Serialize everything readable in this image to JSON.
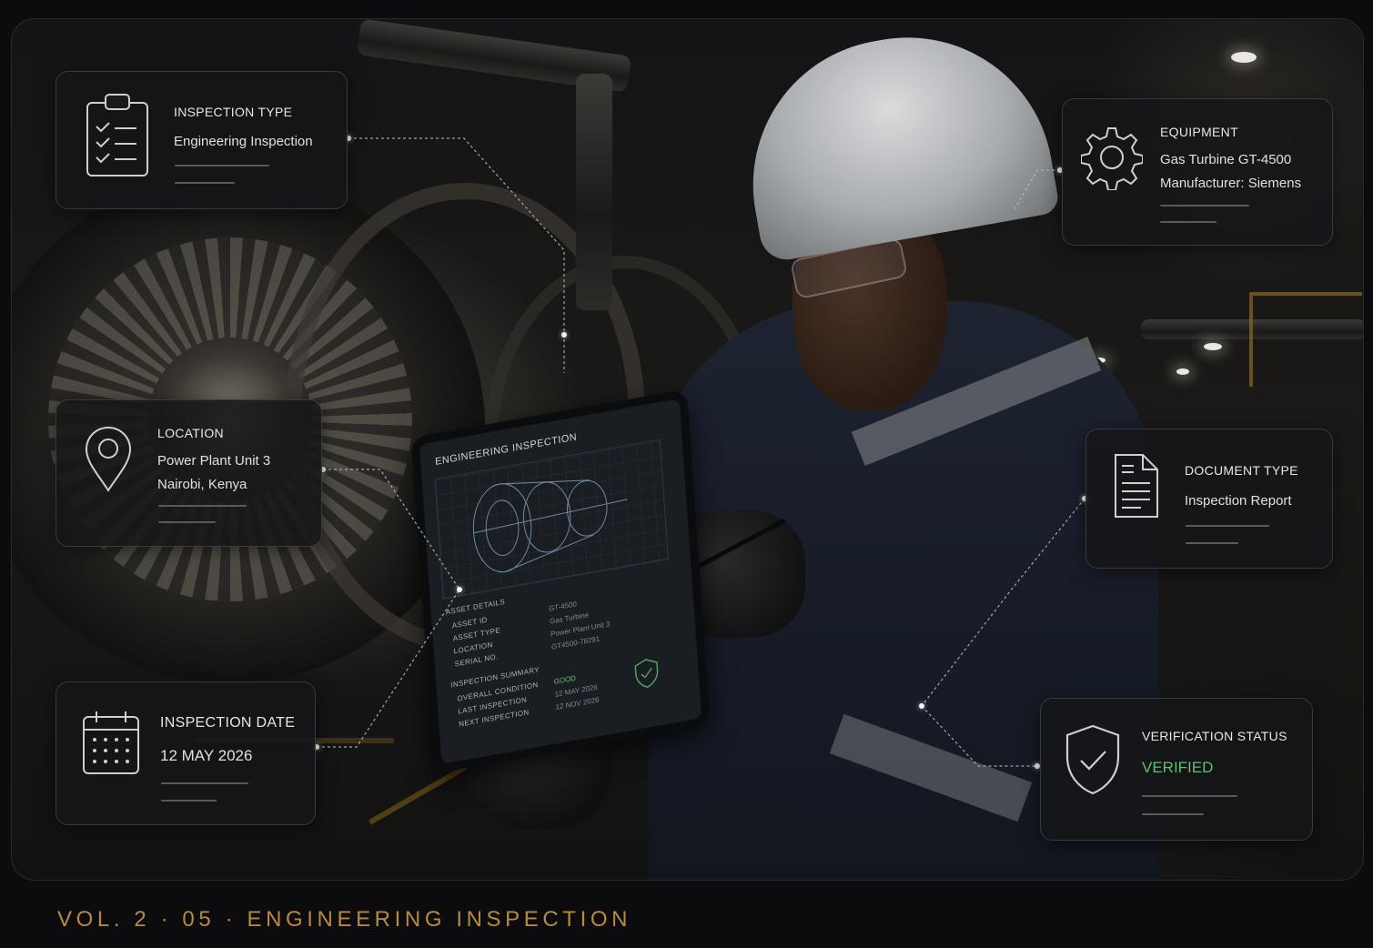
{
  "panels": {
    "inspection_type": {
      "title": "INSPECTION TYPE",
      "value": "Engineering Inspection"
    },
    "equipment": {
      "title": "EQUIPMENT",
      "line1": "Gas Turbine GT-4500",
      "line2": "Manufacturer: Siemens"
    },
    "location": {
      "title": "LOCATION",
      "line1": "Power Plant Unit 3",
      "line2": "Nairobi, Kenya"
    },
    "document_type": {
      "title": "DOCUMENT TYPE",
      "value": "Inspection Report"
    },
    "inspection_date": {
      "title": "INSPECTION DATE",
      "value": "12 MAY 2026"
    },
    "verification": {
      "title": "VERIFICATION STATUS",
      "value": "VERIFIED",
      "value_color": "#5fbf6e"
    }
  },
  "tablet": {
    "title": "ENGINEERING INSPECTION",
    "asset_details": "ASSET DETAILS",
    "asset_id_label": "ASSET ID",
    "asset_id": "GT-4500",
    "asset_type_label": "ASSET TYPE",
    "asset_type": "Gas Turbine",
    "location_label": "LOCATION",
    "location": "Power Plant Unit 3",
    "serial_label": "SERIAL NO.",
    "serial": "GT4500-78291",
    "summary": "INSPECTION SUMMARY",
    "overall_label": "OVERALL CONDITION",
    "overall": "GOOD",
    "last_label": "LAST INSPECTION",
    "last": "12 MAY 2026",
    "next_label": "NEXT INSPECTION",
    "next": "12 NOV 2026"
  },
  "icons": {
    "inspection_type": "clipboard-check-icon",
    "equipment": "gear-icon",
    "location": "map-pin-icon",
    "document_type": "document-icon",
    "inspection_date": "calendar-icon",
    "verification": "shield-check-icon"
  },
  "footer": {
    "text": "VOL. 2 · 05 · ENGINEERING INSPECTION",
    "color": "#b8893f"
  }
}
